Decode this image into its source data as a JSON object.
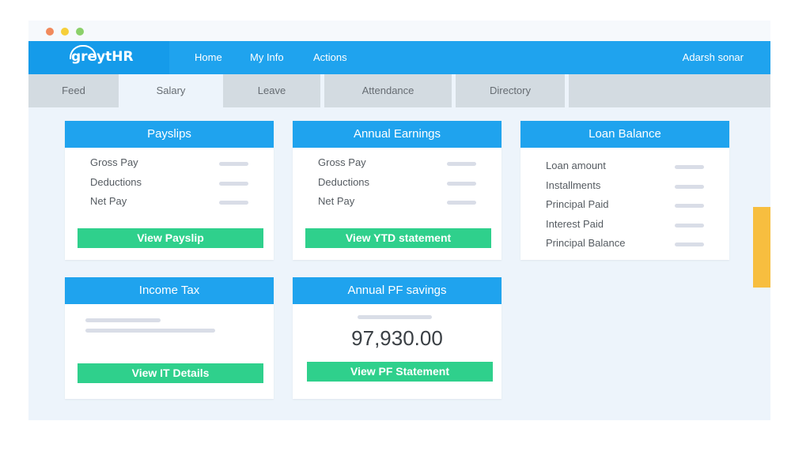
{
  "window": {
    "controls": [
      "close",
      "minimize",
      "maximize"
    ]
  },
  "brand": {
    "logo_text": "greytHR",
    "icon": "cloud-icon"
  },
  "nav": {
    "items": [
      "Home",
      "My Info",
      "Actions"
    ],
    "user": "Adarsh sonar"
  },
  "tabs": {
    "items": [
      "Feed",
      "Salary",
      "Leave",
      "Attendance",
      "Directory"
    ],
    "active": "Salary"
  },
  "cards": {
    "payslips": {
      "title": "Payslips",
      "rows": [
        "Gross Pay",
        "Deductions",
        "Net Pay"
      ],
      "button": "View Payslip"
    },
    "annual_earnings": {
      "title": "Annual Earnings",
      "rows": [
        "Gross Pay",
        "Deductions",
        "Net Pay"
      ],
      "button": "View YTD statement"
    },
    "loan_balance": {
      "title": "Loan Balance",
      "rows": [
        "Loan amount",
        "Installments",
        "Principal Paid",
        "Interest Paid",
        "Principal Balance"
      ]
    },
    "income_tax": {
      "title": "Income Tax",
      "button": "View IT Details"
    },
    "annual_pf": {
      "title": "Annual PF savings",
      "amount": "97,930.00",
      "button": "View PF Statement"
    }
  },
  "colors": {
    "header": "#1fa3ee",
    "button": "#2fd08c",
    "scroll_accent": "#f7be3f",
    "background": "#edf4fb"
  }
}
